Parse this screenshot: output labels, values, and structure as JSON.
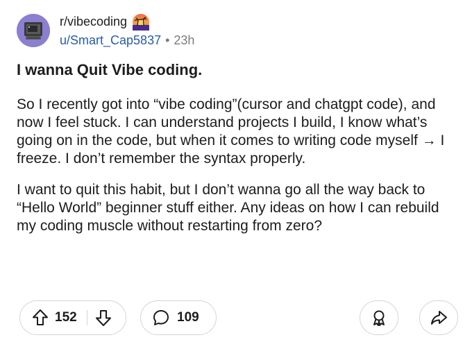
{
  "post": {
    "community": "r/vibecoding",
    "username": "u/Smart_Cap5837",
    "separator": "•",
    "age": "23h",
    "title": "I wanna Quit Vibe coding.",
    "paragraphs": [
      "So I recently got into “vibe coding”(cursor and chatgpt code), and now I feel stuck. I can understand projects I build, I know what’s going on in the code, but when it comes to writing code myself → I freeze. I don’t remember the syntax properly.",
      "I want to quit this habit, but I don’t wanna go all the way back to “Hello World” beginner stuff either. Any ideas on how I can rebuild my coding muscle without restarting from zero?"
    ]
  },
  "actions": {
    "upvotes": "152",
    "comments": "109"
  },
  "icons": {
    "avatar": "retro-computer-icon",
    "badge": "palm-tree-sunset-icon",
    "upvote": "arrow-up-icon",
    "downvote": "arrow-down-icon",
    "comment": "speech-bubble-icon",
    "award": "award-ribbon-icon",
    "share": "share-arrow-icon"
  },
  "colors": {
    "avatar_bg": "#8b7fd1",
    "username": "#2a5ba8",
    "muted": "#7c7c7c",
    "border": "#d4d4d4",
    "text": "#1c1c1c"
  }
}
